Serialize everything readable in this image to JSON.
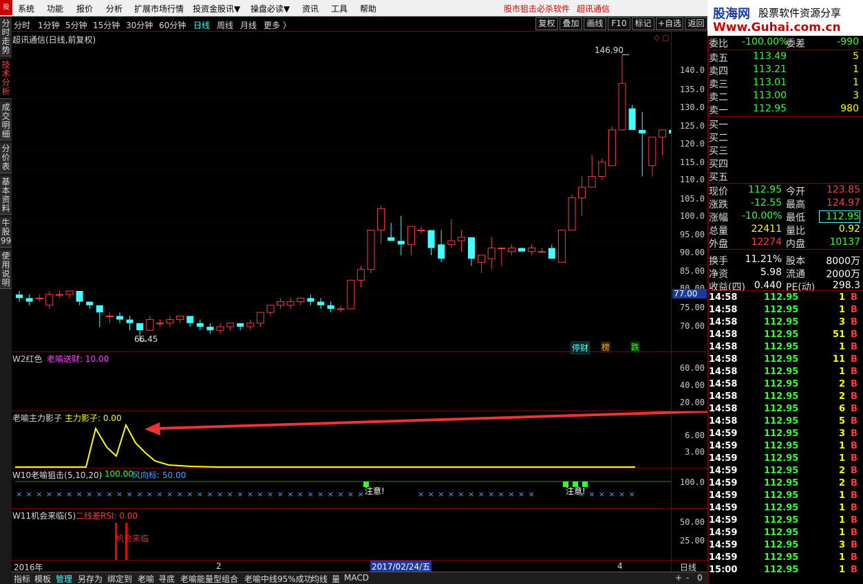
{
  "menubar": {
    "logo": "股",
    "items": [
      "系统",
      "功能",
      "报价",
      "分析",
      "扩展市场行情",
      "投资金股讯▼",
      "操盘必读▼",
      "资讯",
      "工具",
      "帮助"
    ],
    "promo1": "股市狙击必杀软件",
    "promo2": "超讯通信"
  },
  "side_tabs": [
    "分时走势",
    "技术分析",
    "成交明细",
    "分价表",
    "基本资料",
    "牛股99",
    "使用说明"
  ],
  "period_bar": {
    "items": [
      "分时",
      "1分钟",
      "5分钟",
      "15分钟",
      "30分钟",
      "60分钟",
      "日线",
      "周线",
      "月线",
      "更多 〉"
    ],
    "selected": "日线",
    "buttons": [
      "复权",
      "叠加",
      "画线",
      "F10",
      "标记",
      "+自选",
      "返回"
    ]
  },
  "main_chart": {
    "title": "超讯通信(日线,前复权)",
    "high_label": "146.90",
    "low_label": "66.45",
    "price_box": "77.00",
    "tags": [
      "停财",
      "榜",
      "跌"
    ],
    "y_labels": [
      "140.0",
      "135.0",
      "130.0",
      "125.0",
      "120.0",
      "115.0",
      "110.0",
      "105.0",
      "100.0",
      "95.00",
      "90.00",
      "85.00",
      "80.00",
      "75.00",
      "70.00"
    ]
  },
  "chart_data": {
    "type": "candlestick",
    "title": "超讯通信(日线,前复权)",
    "ylim": [
      66,
      150
    ],
    "ohlc": [
      [
        80,
        81,
        78,
        79
      ],
      [
        79,
        80,
        77,
        78
      ],
      [
        79,
        80,
        78,
        79
      ],
      [
        77,
        81,
        76,
        80
      ],
      [
        80,
        81,
        79,
        80
      ],
      [
        80,
        81,
        79,
        81
      ],
      [
        81,
        81,
        77,
        78
      ],
      [
        78,
        78,
        76,
        77
      ],
      [
        77,
        77,
        71,
        75
      ],
      [
        74,
        75,
        72,
        74
      ],
      [
        74,
        75,
        72,
        73
      ],
      [
        73,
        74,
        70,
        72
      ],
      [
        72,
        72,
        67,
        70
      ],
      [
        70,
        74,
        70,
        73
      ],
      [
        72,
        73,
        71,
        72
      ],
      [
        72,
        74,
        71,
        73
      ],
      [
        73,
        74,
        72,
        74
      ],
      [
        74,
        74,
        71,
        72
      ],
      [
        72,
        73,
        70,
        71
      ],
      [
        71,
        72,
        69,
        70
      ],
      [
        70,
        72,
        69,
        71
      ],
      [
        71,
        72,
        70,
        72
      ],
      [
        72,
        72,
        70,
        71
      ],
      [
        71,
        73,
        70,
        72
      ],
      [
        72,
        75,
        71,
        75
      ],
      [
        75,
        77,
        74,
        77
      ],
      [
        77,
        79,
        76,
        78
      ],
      [
        77,
        79,
        76,
        78
      ],
      [
        78,
        79,
        77,
        79
      ],
      [
        79,
        80,
        77,
        78
      ],
      [
        78,
        79,
        76,
        77
      ],
      [
        77,
        78,
        75,
        76
      ],
      [
        76,
        77,
        75,
        76
      ],
      [
        76,
        84,
        76,
        84
      ],
      [
        84,
        88,
        82,
        87
      ],
      [
        87,
        98,
        86,
        98
      ],
      [
        98,
        105,
        94,
        104
      ],
      [
        96,
        100,
        95,
        95
      ],
      [
        95,
        102,
        91,
        94
      ],
      [
        94,
        99,
        91,
        99
      ],
      [
        98,
        99,
        97,
        98
      ],
      [
        98,
        98,
        91,
        93
      ],
      [
        94,
        98,
        89,
        90
      ],
      [
        94,
        101,
        93,
        95
      ],
      [
        95,
        98,
        92,
        96
      ],
      [
        96,
        96,
        88,
        90
      ],
      [
        89,
        91,
        86,
        91
      ],
      [
        90,
        96,
        87,
        93
      ],
      [
        93,
        93,
        88,
        93
      ],
      [
        92,
        94,
        91,
        93
      ],
      [
        93,
        93,
        92,
        92
      ],
      [
        92,
        94,
        91,
        93
      ],
      [
        92,
        93,
        92,
        92
      ],
      [
        93,
        94,
        90,
        90
      ],
      [
        89,
        98,
        89,
        98
      ],
      [
        98,
        108,
        98,
        107
      ],
      [
        107,
        113,
        102,
        110
      ],
      [
        110,
        119,
        110,
        113
      ],
      [
        113,
        118,
        112,
        117
      ],
      [
        116,
        127,
        116,
        126
      ],
      [
        126,
        147,
        126,
        139
      ],
      [
        132,
        133,
        126,
        126
      ],
      [
        126,
        131,
        113,
        125
      ],
      [
        116,
        124,
        113,
        124
      ],
      [
        124,
        126,
        119,
        126
      ],
      [
        126,
        127,
        125,
        125
      ],
      [
        125,
        126,
        112,
        113
      ]
    ],
    "indicators": {
      "w2": {
        "label": "W2红色",
        "value": "老喻送财: 10.00",
        "ticks": [
          "60.00",
          "40.00",
          "20.00"
        ]
      },
      "shadow": {
        "label": "老喻主力影子",
        "value": "主力影子: 0.00",
        "ticks": [
          "6.00",
          "3.00"
        ]
      },
      "w10": {
        "label": "W10老喻狙击(5,10,20)",
        "value": ": 100.00",
        "wind": "风向标: 50.00",
        "tick": "100.0",
        "notes": [
          "注意!",
          "注意!"
        ]
      },
      "w11": {
        "label": "W11机会来临(5)",
        "value": "二线差RSI: 0.00",
        "ticks": [
          "50.00",
          "25.00"
        ],
        "note": "机会来临"
      }
    }
  },
  "xaxis": {
    "year": "2016年",
    "mark2": "2",
    "date_box": "2017/02/24/五",
    "mark4": "4",
    "period": "日线"
  },
  "bottom_tabs": [
    "指标",
    "模板",
    "管理",
    "另存为",
    "绑定到",
    "老喻",
    "寻底",
    "老喻能量型组合",
    "老喻中线95%成功",
    "均线",
    "量",
    "MACD"
  ],
  "bottom_right": [
    "+",
    "-",
    "0"
  ],
  "ad": {
    "brand": "股海网",
    "url": "Www.Guhai.com.cn",
    "tagline": "股票软件资源分享"
  },
  "order_book": {
    "top": {
      "label": "委比",
      "value": "-100.00%",
      "label2": "委差",
      "value2": "-990"
    },
    "sells": [
      {
        "label": "卖五",
        "price": "113.49",
        "vol": "5"
      },
      {
        "label": "卖四",
        "price": "113.21",
        "vol": "1"
      },
      {
        "label": "卖三",
        "price": "113.01",
        "vol": "1"
      },
      {
        "label": "卖二",
        "price": "113.00",
        "vol": "3"
      },
      {
        "label": "卖一",
        "price": "112.95",
        "vol": "980"
      }
    ],
    "buys": [
      "买一",
      "买二",
      "买三",
      "买四",
      "买五"
    ]
  },
  "quote": [
    {
      "l1": "现价",
      "v1": "112.95",
      "l2": "今开",
      "v2": "123.85"
    },
    {
      "l1": "涨跌",
      "v1": "-12.55",
      "l2": "最高",
      "v2": "124.97"
    },
    {
      "l1": "涨幅",
      "v1": "-10.00%",
      "l2": "最低",
      "v2": "112.95"
    },
    {
      "l1": "总量",
      "v1": "22411",
      "l2": "量比",
      "v2": "0.92"
    },
    {
      "l1": "外盘",
      "v1": "12274",
      "l2": "内盘",
      "v2": "10137"
    },
    {
      "l1": "换手",
      "v1": "11.21%",
      "l2": "股本",
      "v2": "8000万"
    },
    {
      "l1": "净资",
      "v1": "5.98",
      "l2": "流通",
      "v2": "2000万"
    },
    {
      "l1": "收益(四)",
      "v1": "0.440",
      "l2": "PE(动)",
      "v2": "298.3"
    }
  ],
  "ticks": [
    {
      "t": "14:58",
      "p": "112.95",
      "v": "1",
      "s": "B"
    },
    {
      "t": "14:58",
      "p": "112.95",
      "v": "1",
      "s": "B"
    },
    {
      "t": "14:58",
      "p": "112.95",
      "v": "3",
      "s": "B"
    },
    {
      "t": "14:58",
      "p": "112.95",
      "v": "51",
      "s": "B"
    },
    {
      "t": "14:58",
      "p": "112.95",
      "v": "1",
      "s": "B"
    },
    {
      "t": "14:58",
      "p": "112.95",
      "v": "11",
      "s": "B"
    },
    {
      "t": "14:58",
      "p": "112.95",
      "v": "1",
      "s": "B"
    },
    {
      "t": "14:58",
      "p": "112.95",
      "v": "2",
      "s": "B"
    },
    {
      "t": "14:58",
      "p": "112.95",
      "v": "2",
      "s": "B"
    },
    {
      "t": "14:58",
      "p": "112.95",
      "v": "6",
      "s": "B"
    },
    {
      "t": "14:58",
      "p": "112.95",
      "v": "5",
      "s": "B"
    },
    {
      "t": "14:59",
      "p": "112.95",
      "v": "3",
      "s": "B"
    },
    {
      "t": "14:59",
      "p": "112.95",
      "v": "1",
      "s": "B"
    },
    {
      "t": "14:59",
      "p": "112.95",
      "v": "1",
      "s": "B"
    },
    {
      "t": "14:59",
      "p": "112.95",
      "v": "2",
      "s": "B"
    },
    {
      "t": "14:59",
      "p": "112.95",
      "v": "2",
      "s": "B"
    },
    {
      "t": "14:59",
      "p": "112.95",
      "v": "1",
      "s": "B"
    },
    {
      "t": "14:59",
      "p": "112.95",
      "v": "1",
      "s": "B"
    },
    {
      "t": "14:59",
      "p": "112.95",
      "v": "1",
      "s": "B"
    },
    {
      "t": "14:59",
      "p": "112.95",
      "v": "1",
      "s": "B"
    },
    {
      "t": "14:59",
      "p": "112.95",
      "v": "3",
      "s": "B"
    },
    {
      "t": "14:59",
      "p": "112.95",
      "v": "1",
      "s": "B"
    },
    {
      "t": "15:00",
      "p": "112.95",
      "v": "1",
      "s": "B"
    }
  ],
  "colors": {
    "up": "#ff3b3b",
    "down": "#4ff",
    "green": "#3f3",
    "yellow": "#ff0",
    "grid": "#8b0000"
  }
}
